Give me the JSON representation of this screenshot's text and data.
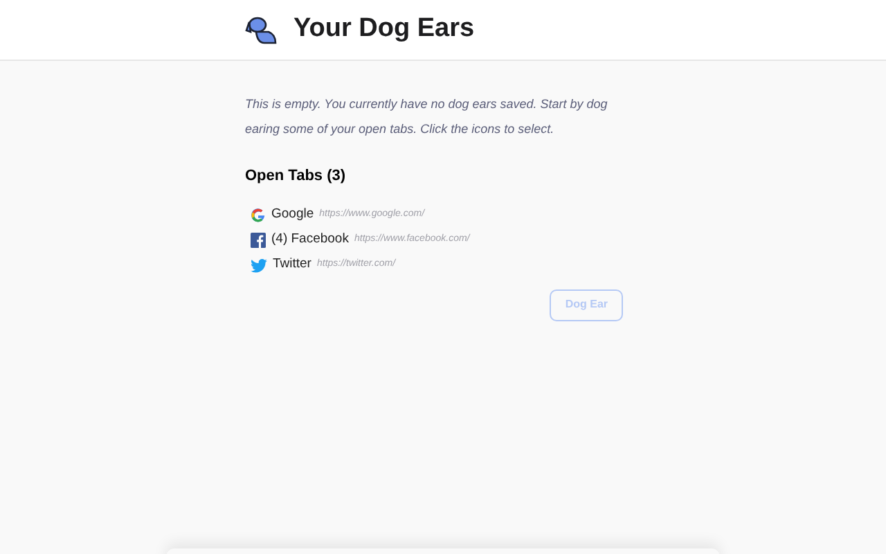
{
  "header": {
    "title": "Your Dog Ears"
  },
  "message": "This is empty. You currently have no dog ears saved. Start by dog earing some of your open tabs. Click the icons to select.",
  "open_tabs": {
    "heading": "Open Tabs (3)",
    "tabs": [
      {
        "kind": "google",
        "title": "Google",
        "url": "https://www.google.com/"
      },
      {
        "kind": "facebook",
        "title": "(4) Facebook",
        "url": "https://www.facebook.com/"
      },
      {
        "kind": "twitter",
        "title": "Twitter",
        "url": "https://twitter.com/"
      }
    ]
  },
  "button": {
    "label": "Dog Ear",
    "disabled": true
  }
}
